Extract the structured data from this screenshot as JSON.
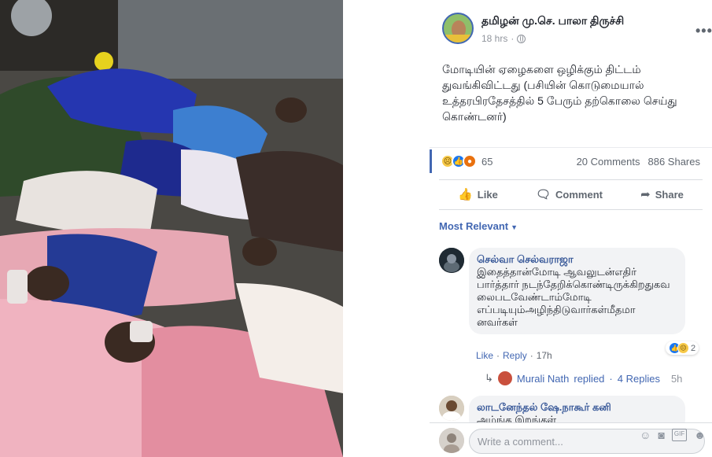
{
  "post": {
    "page_name": "தமிழன் மு.செ. பாலா திருச்சி",
    "time": "18 hrs",
    "dot": "·",
    "text": "மோடியின் ஏழைகளை ஒழிக்கும் திட்டம் துவங்கிவிட்டது (பசியின் கொடுமையால் உத்தரபிரதேசத்தில் 5 பேரும் தற்கொலை செய்து கொண்டனர்)",
    "more_icon": "more-options-icon"
  },
  "reactions": {
    "count": "65",
    "types": [
      "sad",
      "like",
      "angry"
    ],
    "comments": "20 Comments",
    "shares": "886 Shares"
  },
  "actions": {
    "like": "Like",
    "comment": "Comment",
    "share": "Share"
  },
  "sort": {
    "label": "Most Relevant"
  },
  "comments": [
    {
      "author": "செல்வா செல்வராஜா",
      "text": "இதைத்தான்மோடி ஆவலுடன்எதிர் பார்த்தார் நடந்தேறிக்கொண்டிருக்கிறதுகவ லைபடவேண்டாம்மோடி எப்படியும்அழிந்திடுவார்கள்மீதமா னவர்கள்",
      "like": "Like",
      "reply": "Reply",
      "time": "17h",
      "reaction_count": "2"
    },
    {
      "author": "லாடனேந்தல் ஷே.நாகூர் கனி",
      "text": "அம்ங்க இறங்கள்"
    }
  ],
  "replies": {
    "name": "Murali Nath",
    "replied": "replied",
    "count": "4 Replies",
    "time": "5h"
  },
  "composer": {
    "placeholder": "Write a comment..."
  },
  "colors": {
    "accent": "#4267b2",
    "link": "#385898",
    "muted": "#606770"
  }
}
